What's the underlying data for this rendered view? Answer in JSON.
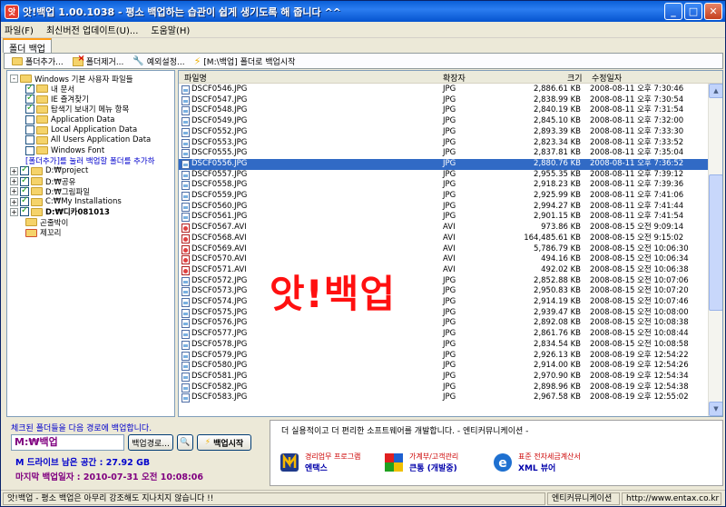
{
  "window": {
    "icon_text": "앗",
    "title": "앗!백업 1.00.1038  -  평소 백업하는 습관이 쉽게 생기도록 해 줍니다 ^^"
  },
  "menu": [
    "파일(F)",
    "최신버전 업데이트(U)...",
    "도움말(H)"
  ],
  "tab": "폴더 백업",
  "toolbar": {
    "add": "폴더추가...",
    "remove": "폴더제거...",
    "exclude": "예외설정...",
    "backup_to": "[M:\\백업] 폴더로 백업시작"
  },
  "tree": {
    "root": "Windows 기본 사용자 파일들",
    "children": [
      {
        "label": "내 문서",
        "checked": true
      },
      {
        "label": "IE 즐겨찾기",
        "checked": true
      },
      {
        "label": "탐색기 보내기 메뉴 항목",
        "checked": true
      },
      {
        "label": "Application Data",
        "checked": false
      },
      {
        "label": "Local Application Data",
        "checked": false
      },
      {
        "label": "All Users Application Data",
        "checked": false
      },
      {
        "label": "Windows Font",
        "checked": false
      }
    ],
    "hint": "[폴더추가]를 눌러 백업할 폴더를 추가하",
    "folders": [
      {
        "label": "D:₩project",
        "checked": true
      },
      {
        "label": "D:₩공유",
        "checked": true
      },
      {
        "label": "D:₩그림파일",
        "checked": true
      },
      {
        "label": "C:₩My Installations",
        "checked": true
      },
      {
        "label": "D:₩디카081013",
        "checked": true
      }
    ],
    "sub": [
      "곤줄박이",
      "제꼬리"
    ]
  },
  "list": {
    "columns": [
      "파일명",
      "확장자",
      "크기",
      "수정일자"
    ],
    "selected_index": 10,
    "rows": [
      [
        "DSCF0546.JPG",
        "JPG",
        "2,886.61 KB",
        "2008-08-11 오후 7:30:46"
      ],
      [
        "DSCF0547.JPG",
        "JPG",
        "2,838.99 KB",
        "2008-08-11 오후 7:30:54"
      ],
      [
        "DSCF0548.JPG",
        "JPG",
        "2,840.19 KB",
        "2008-08-11 오후 7:31:54"
      ],
      [
        "DSCF0549.JPG",
        "JPG",
        "2,845.10 KB",
        "2008-08-11 오후 7:32:00"
      ],
      [
        "DSCF0552.JPG",
        "JPG",
        "2,893.39 KB",
        "2008-08-11 오후 7:33:30"
      ],
      [
        "DSCF0553.JPG",
        "JPG",
        "2,823.34 KB",
        "2008-08-11 오후 7:33:52"
      ],
      [
        "DSCF0555.JPG",
        "JPG",
        "2,837.81 KB",
        "2008-08-11 오후 7:35:04"
      ],
      [
        "DSCF0556.JPG",
        "JPG",
        "2,880.76 KB",
        "2008-08-11 오후 7:36:52"
      ],
      [
        "DSCF0557.JPG",
        "JPG",
        "2,955.35 KB",
        "2008-08-11 오후 7:39:12"
      ],
      [
        "DSCF0558.JPG",
        "JPG",
        "2,918.23 KB",
        "2008-08-11 오후 7:39:36"
      ],
      [
        "DSCF0559.JPG",
        "JPG",
        "2,925.99 KB",
        "2008-08-11 오후 7:41:06"
      ],
      [
        "DSCF0560.JPG",
        "JPG",
        "2,994.27 KB",
        "2008-08-11 오후 7:41:44"
      ],
      [
        "DSCF0561.JPG",
        "JPG",
        "2,901.15 KB",
        "2008-08-11 오후 7:41:54"
      ],
      [
        "DSCF0567.AVI",
        "AVI",
        "973.86 KB",
        "2008-08-15 오전 9:09:14"
      ],
      [
        "DSCF0568.AVI",
        "AVI",
        "164,485.61 KB",
        "2008-08-15 오전 9:15:02"
      ],
      [
        "DSCF0569.AVI",
        "AVI",
        "5,786.79 KB",
        "2008-08-15 오전 10:06:30"
      ],
      [
        "DSCF0570.AVI",
        "AVI",
        "494.16 KB",
        "2008-08-15 오전 10:06:34"
      ],
      [
        "DSCF0571.AVI",
        "AVI",
        "492.02 KB",
        "2008-08-15 오전 10:06:38"
      ],
      [
        "DSCF0572.JPG",
        "JPG",
        "2,852.88 KB",
        "2008-08-15 오전 10:07:06"
      ],
      [
        "DSCF0573.JPG",
        "JPG",
        "2,950.83 KB",
        "2008-08-15 오전 10:07:20"
      ],
      [
        "DSCF0574.JPG",
        "JPG",
        "2,914.19 KB",
        "2008-08-15 오전 10:07:46"
      ],
      [
        "DSCF0575.JPG",
        "JPG",
        "2,939.47 KB",
        "2008-08-15 오전 10:08:00"
      ],
      [
        "DSCF0576.JPG",
        "JPG",
        "2,892.08 KB",
        "2008-08-15 오전 10:08:38"
      ],
      [
        "DSCF0577.JPG",
        "JPG",
        "2,861.76 KB",
        "2008-08-15 오전 10:08:44"
      ],
      [
        "DSCF0578.JPG",
        "JPG",
        "2,834.54 KB",
        "2008-08-15 오전 10:08:58"
      ],
      [
        "DSCF0579.JPG",
        "JPG",
        "2,926.13 KB",
        "2008-08-19 오후 12:54:22"
      ],
      [
        "DSCF0580.JPG",
        "JPG",
        "2,914.00 KB",
        "2008-08-19 오후 12:54:26"
      ],
      [
        "DSCF0581.JPG",
        "JPG",
        "2,970.90 KB",
        "2008-08-19 오후 12:54:34"
      ],
      [
        "DSCF0582.JPG",
        "JPG",
        "2,898.96 KB",
        "2008-08-19 오후 12:54:38"
      ],
      [
        "DSCF0583.JPG",
        "JPG",
        "2,967.58 KB",
        "2008-08-19 오후 12:55:02"
      ]
    ]
  },
  "watermark": "앗!백업",
  "backup": {
    "caption": "체크된 폴더들을 다음 경로에 백업합니다.",
    "path": "M:₩백업",
    "path_btn": "백업경로...",
    "start_btn": "백업시작",
    "free_space": "M 드라이브 남은 공간 : 27.92 GB",
    "last_backup": "마지막 백업일자 : 2010-07-31 오전 10:08:06"
  },
  "ad": {
    "text": "더 실용적이고 더 편리한 소프트웨어를 개발합니다. - 엔티커뮤니케이션 -",
    "products": [
      {
        "sub": "경리업무 프로그램",
        "name": "엔택스"
      },
      {
        "sub": "가계부/고객관리",
        "name": "큰통 (개발중)"
      },
      {
        "sub": "표준 전자세금계산서",
        "name": "XML 뷰어"
      }
    ]
  },
  "status": {
    "message": "앗!백업 - 평소 백업은 아무리 강조해도 지나치지 않습니다 !!",
    "company": "엔티커뮤니케이션",
    "url": "http://www.entax.co.kr"
  }
}
